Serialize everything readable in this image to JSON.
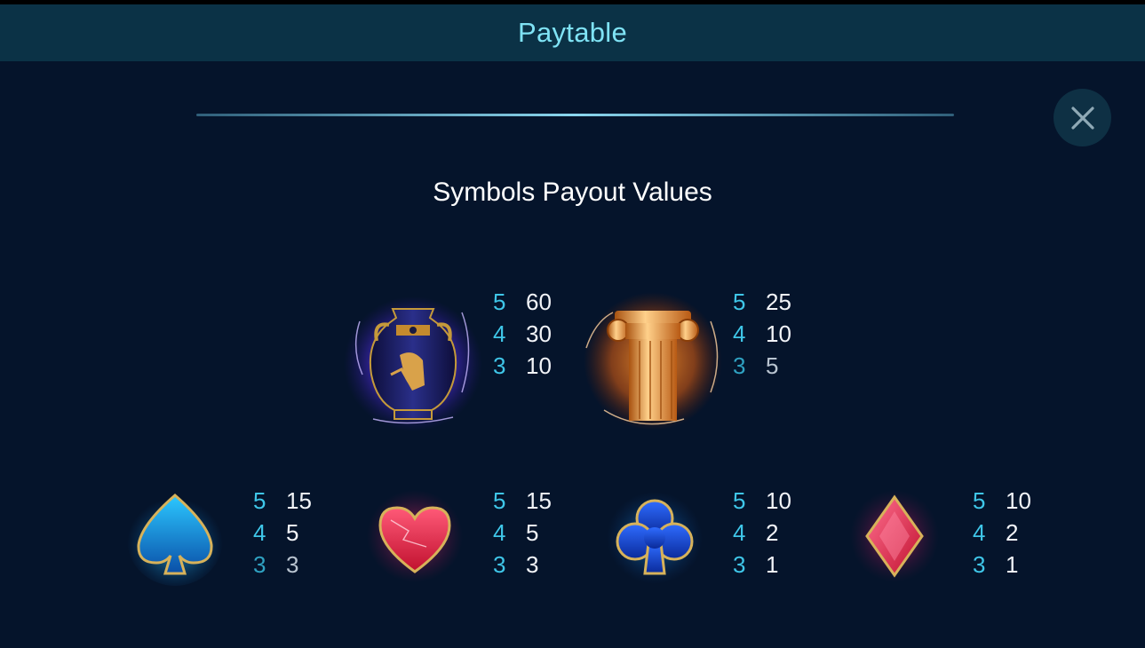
{
  "header": {
    "title": "Paytable"
  },
  "close": {
    "icon": "close-icon"
  },
  "section": {
    "title": "Symbols Payout Values"
  },
  "colors": {
    "accent": "#7fe3f5",
    "count": "#3fc6e8",
    "background": "#05142b",
    "header_bg": "#0b3246"
  },
  "symbols": [
    {
      "name": "amphora",
      "icon": "amphora-icon",
      "payouts": [
        {
          "count": "5",
          "value": "60"
        },
        {
          "count": "4",
          "value": "30"
        },
        {
          "count": "3",
          "value": "10"
        }
      ]
    },
    {
      "name": "column",
      "icon": "column-icon",
      "payouts": [
        {
          "count": "5",
          "value": "25"
        },
        {
          "count": "4",
          "value": "10"
        },
        {
          "count": "3",
          "value": "5"
        }
      ]
    },
    {
      "name": "spade",
      "icon": "spade-icon",
      "payouts": [
        {
          "count": "5",
          "value": "15"
        },
        {
          "count": "4",
          "value": "5"
        },
        {
          "count": "3",
          "value": "3"
        }
      ]
    },
    {
      "name": "heart",
      "icon": "heart-icon",
      "payouts": [
        {
          "count": "5",
          "value": "15"
        },
        {
          "count": "4",
          "value": "5"
        },
        {
          "count": "3",
          "value": "3"
        }
      ]
    },
    {
      "name": "club",
      "icon": "club-icon",
      "payouts": [
        {
          "count": "5",
          "value": "10"
        },
        {
          "count": "4",
          "value": "2"
        },
        {
          "count": "3",
          "value": "1"
        }
      ]
    },
    {
      "name": "diamond",
      "icon": "diamond-icon",
      "payouts": [
        {
          "count": "5",
          "value": "10"
        },
        {
          "count": "4",
          "value": "2"
        },
        {
          "count": "3",
          "value": "1"
        }
      ]
    }
  ]
}
